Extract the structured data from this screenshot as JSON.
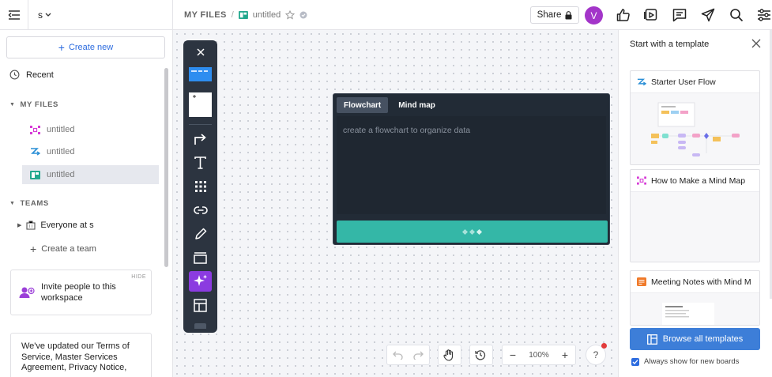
{
  "sidebar": {
    "workspace_name": "s",
    "create_new_label": "Create new",
    "recent_label": "Recent",
    "my_files_heading": "MY FILES",
    "files": [
      {
        "name": "untitled",
        "icon": "mindmap-icon",
        "color": "#d63ad6"
      },
      {
        "name": "untitled",
        "icon": "flowchart-icon",
        "color": "#2a8fd6"
      },
      {
        "name": "untitled",
        "icon": "board-icon",
        "color": "#23a88e",
        "active": true
      }
    ],
    "teams_heading": "TEAMS",
    "team_name": "Everyone at s",
    "create_team_label": "Create a team",
    "invite_text": "Invite people to this workspace",
    "invite_hide": "HIDE",
    "terms_text": "We've updated our Terms of Service, Master Services Agreement, Privacy Notice,"
  },
  "topbar": {
    "breadcrumb_root": "MY FILES",
    "breadcrumb_sep": "/",
    "file_name": "untitled",
    "share_label": "Share",
    "avatar_initial": "V"
  },
  "ai_panel": {
    "tabs": [
      "Flowchart",
      "Mind map"
    ],
    "active_tab": "Flowchart",
    "placeholder": "create a flowchart to organize data",
    "button_color": "#34b7a7"
  },
  "controls": {
    "zoom": "100%",
    "help": "?"
  },
  "templates": {
    "title": "Start with a template",
    "items": [
      {
        "name": "Starter User Flow",
        "icon": "flowchart-icon",
        "color": "#2a8fd6"
      },
      {
        "name": "How to Make a Mind Map",
        "icon": "mindmap-icon",
        "color": "#d63ad6"
      },
      {
        "name": "Meeting Notes with Mind M",
        "icon": "document-icon",
        "color": "#f07a2a"
      }
    ],
    "browse_label": "Browse all templates",
    "always_show_label": "Always show for new boards",
    "accent": "#3d7ed8"
  }
}
